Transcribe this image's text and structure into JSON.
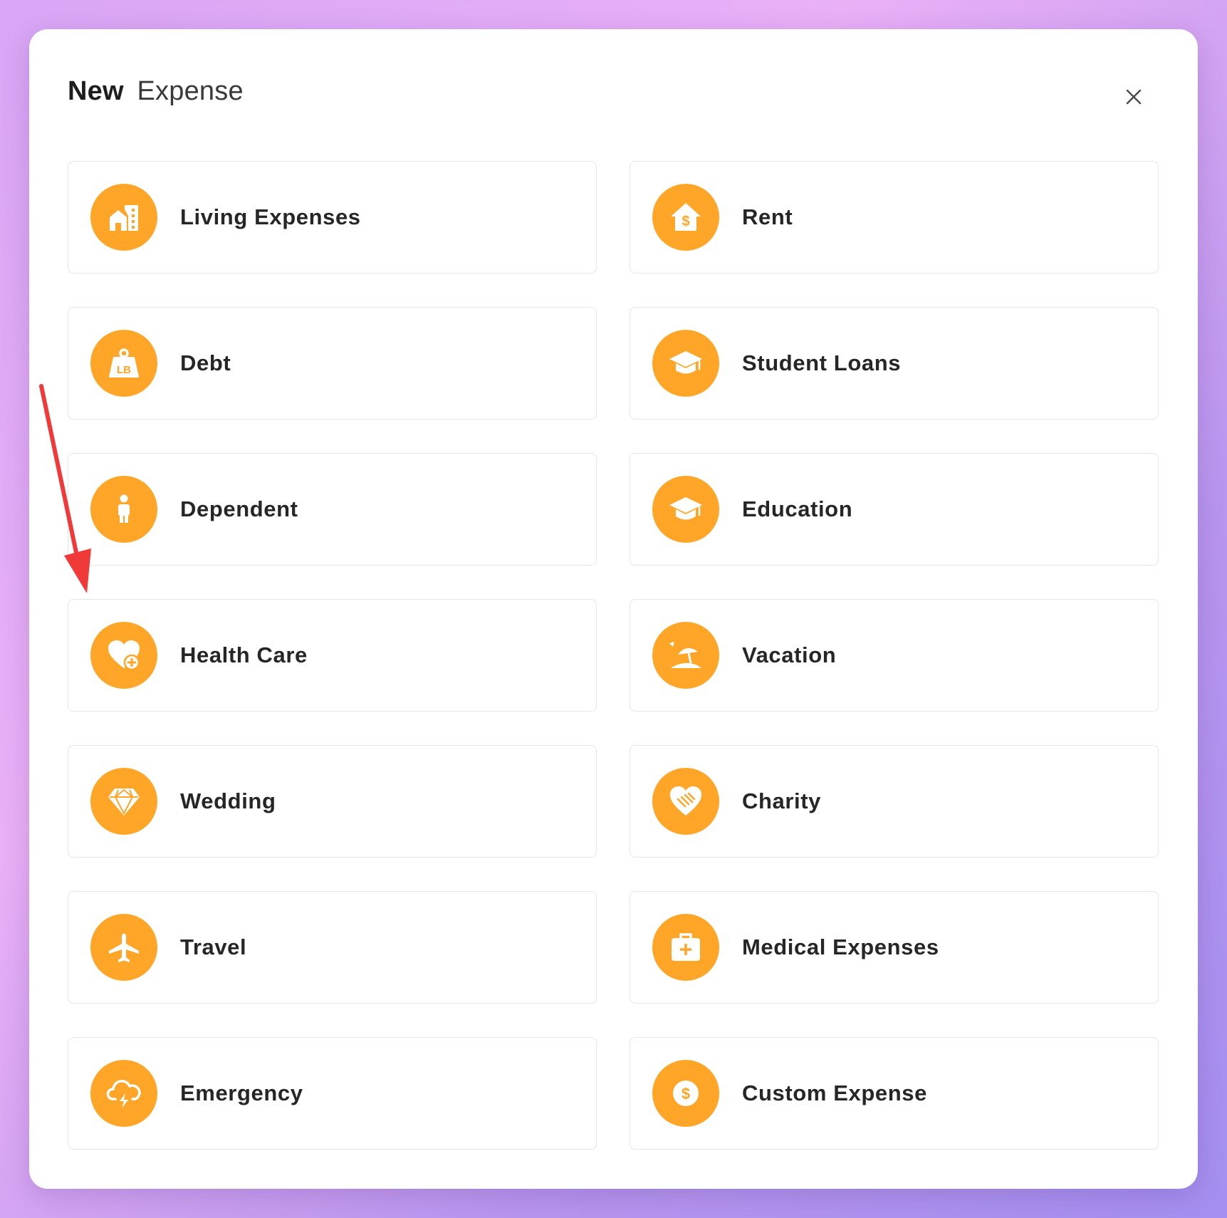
{
  "modal": {
    "title_strong": "New",
    "title_light": "Expense",
    "close_icon": "close-icon"
  },
  "categories": [
    {
      "label": "Living Expenses",
      "icon": "building-icon"
    },
    {
      "label": "Rent",
      "icon": "house-dollar-icon"
    },
    {
      "label": "Debt",
      "icon": "weight-lb-icon"
    },
    {
      "label": "Student Loans",
      "icon": "graduation-cap-icon"
    },
    {
      "label": "Dependent",
      "icon": "child-icon"
    },
    {
      "label": "Education",
      "icon": "graduation-cap-icon"
    },
    {
      "label": "Health Care",
      "icon": "heart-plus-icon"
    },
    {
      "label": "Vacation",
      "icon": "beach-umbrella-icon"
    },
    {
      "label": "Wedding",
      "icon": "diamond-icon"
    },
    {
      "label": "Charity",
      "icon": "heart-handshake-icon"
    },
    {
      "label": "Travel",
      "icon": "plane-icon"
    },
    {
      "label": "Medical Expenses",
      "icon": "medical-kit-icon"
    },
    {
      "label": "Emergency",
      "icon": "cloud-lightning-icon"
    },
    {
      "label": "Custom Expense",
      "icon": "dollar-coin-icon"
    }
  ],
  "colors": {
    "accent": "#ffa629",
    "annotation_arrow": "#f03a3a"
  }
}
